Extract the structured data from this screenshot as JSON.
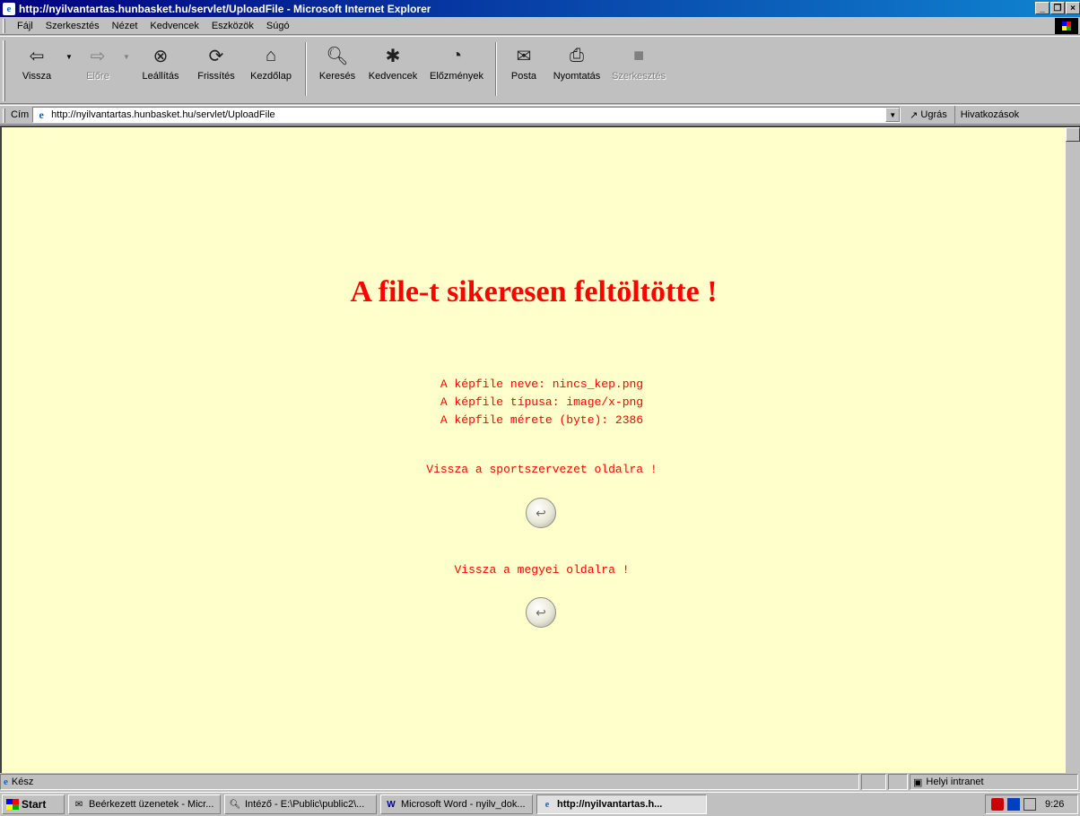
{
  "window": {
    "title": "http://nyilvantartas.hunbasket.hu/servlet/UploadFile - Microsoft Internet Explorer"
  },
  "menu": [
    "Fájl",
    "Szerkesztés",
    "Nézet",
    "Kedvencek",
    "Eszközök",
    "Súgó"
  ],
  "toolbar": {
    "back": "Vissza",
    "forward": "Előre",
    "stop": "Leállítás",
    "refresh": "Frissítés",
    "home": "Kezdőlap",
    "search": "Keresés",
    "favorites": "Kedvencek",
    "history": "Előzmények",
    "mail": "Posta",
    "print": "Nyomtatás",
    "edit": "Szerkesztés"
  },
  "address": {
    "label": "Cím",
    "url": "http://nyilvantartas.hunbasket.hu/servlet/UploadFile",
    "go": "Ugrás",
    "links": "Hivatkozások"
  },
  "content": {
    "heading": "A file-t sikeresen feltöltötte !",
    "file_name_line": "A képfile neve: nincs_kep.png",
    "file_type_line": "A képfile típusa: image/x-png",
    "file_size_line": "A képfile mérete (byte): 2386",
    "back_org_link": "Vissza a sportszervezet oldalra !",
    "back_county_link": "Vissza a megyei oldalra !"
  },
  "status": {
    "text": "Kész",
    "zone": "Helyi intranet"
  },
  "taskbar": {
    "start": "Start",
    "tasks": [
      "Beérkezett üzenetek - Micr...",
      "Intéző - E:\\Public\\public2\\...",
      "Microsoft Word - nyilv_dok...",
      "http://nyilvantartas.h..."
    ],
    "clock": "9:26"
  }
}
